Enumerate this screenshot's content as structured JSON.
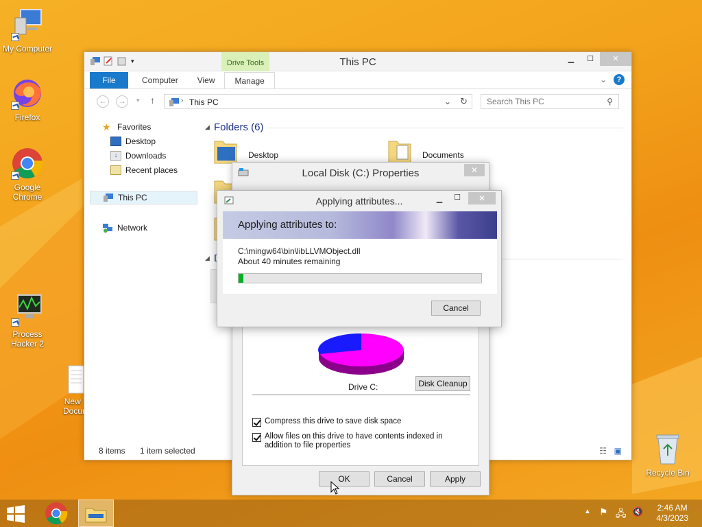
{
  "desktop": {
    "icons": [
      {
        "label": "My Computer"
      },
      {
        "label": "Firefox"
      },
      {
        "label": "Google Chrome"
      },
      {
        "label": "Process Hacker 2"
      },
      {
        "label": "New T Docum"
      },
      {
        "label": "Recycle Bin"
      }
    ]
  },
  "explorer": {
    "title": "This PC",
    "drive_tools_label": "Drive Tools",
    "tabs": [
      "File",
      "Computer",
      "View",
      "Manage"
    ],
    "address": "This PC",
    "search_placeholder": "Search This PC",
    "nav": {
      "favorites": "Favorites",
      "desktop": "Desktop",
      "downloads": "Downloads",
      "recent": "Recent places",
      "this_pc": "This PC",
      "network": "Network"
    },
    "folders_header": "Folders (6)",
    "devices_header_fragment": "D",
    "folders": [
      "Desktop",
      "Documents"
    ],
    "status_items": "8 items",
    "status_selected": "1 item selected"
  },
  "properties": {
    "title": "Local Disk (C:) Properties",
    "drive_label": "Drive C:",
    "disk_cleanup": "Disk Cleanup",
    "compress": "Compress this drive to save disk space",
    "index": "Allow files on this drive to have contents indexed in addition to file properties",
    "ok": "OK",
    "cancel": "Cancel",
    "apply": "Apply",
    "pie": {
      "used_color": "#ff00ff",
      "free_color": "#1a1aff"
    }
  },
  "applying": {
    "title": "Applying attributes...",
    "heading": "Applying attributes to:",
    "file": "C:\\mingw64\\bin\\libLLVMObject.dll",
    "remaining": "About 40 minutes remaining",
    "progress_fraction": 0.02,
    "cancel": "Cancel"
  },
  "taskbar": {
    "time": "2:46 AM",
    "date": "4/3/2023"
  }
}
